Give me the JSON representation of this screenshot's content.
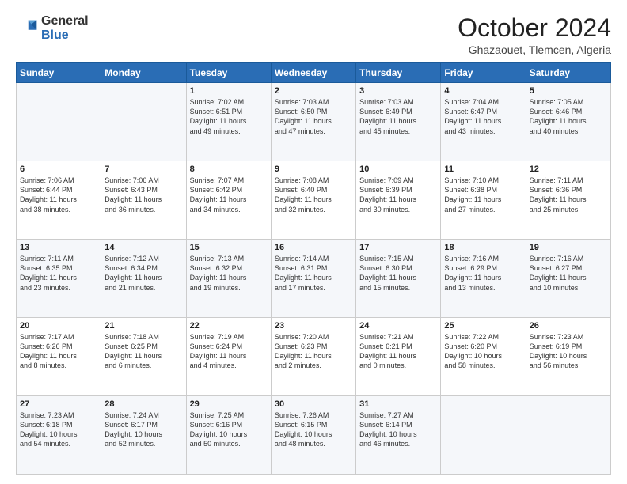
{
  "logo": {
    "general": "General",
    "blue": "Blue"
  },
  "title": "October 2024",
  "location": "Ghazaouet, Tlemcen, Algeria",
  "days_of_week": [
    "Sunday",
    "Monday",
    "Tuesday",
    "Wednesday",
    "Thursday",
    "Friday",
    "Saturday"
  ],
  "weeks": [
    [
      {
        "day": "",
        "info": ""
      },
      {
        "day": "",
        "info": ""
      },
      {
        "day": "1",
        "info": "Sunrise: 7:02 AM\nSunset: 6:51 PM\nDaylight: 11 hours\nand 49 minutes."
      },
      {
        "day": "2",
        "info": "Sunrise: 7:03 AM\nSunset: 6:50 PM\nDaylight: 11 hours\nand 47 minutes."
      },
      {
        "day": "3",
        "info": "Sunrise: 7:03 AM\nSunset: 6:49 PM\nDaylight: 11 hours\nand 45 minutes."
      },
      {
        "day": "4",
        "info": "Sunrise: 7:04 AM\nSunset: 6:47 PM\nDaylight: 11 hours\nand 43 minutes."
      },
      {
        "day": "5",
        "info": "Sunrise: 7:05 AM\nSunset: 6:46 PM\nDaylight: 11 hours\nand 40 minutes."
      }
    ],
    [
      {
        "day": "6",
        "info": "Sunrise: 7:06 AM\nSunset: 6:44 PM\nDaylight: 11 hours\nand 38 minutes."
      },
      {
        "day": "7",
        "info": "Sunrise: 7:06 AM\nSunset: 6:43 PM\nDaylight: 11 hours\nand 36 minutes."
      },
      {
        "day": "8",
        "info": "Sunrise: 7:07 AM\nSunset: 6:42 PM\nDaylight: 11 hours\nand 34 minutes."
      },
      {
        "day": "9",
        "info": "Sunrise: 7:08 AM\nSunset: 6:40 PM\nDaylight: 11 hours\nand 32 minutes."
      },
      {
        "day": "10",
        "info": "Sunrise: 7:09 AM\nSunset: 6:39 PM\nDaylight: 11 hours\nand 30 minutes."
      },
      {
        "day": "11",
        "info": "Sunrise: 7:10 AM\nSunset: 6:38 PM\nDaylight: 11 hours\nand 27 minutes."
      },
      {
        "day": "12",
        "info": "Sunrise: 7:11 AM\nSunset: 6:36 PM\nDaylight: 11 hours\nand 25 minutes."
      }
    ],
    [
      {
        "day": "13",
        "info": "Sunrise: 7:11 AM\nSunset: 6:35 PM\nDaylight: 11 hours\nand 23 minutes."
      },
      {
        "day": "14",
        "info": "Sunrise: 7:12 AM\nSunset: 6:34 PM\nDaylight: 11 hours\nand 21 minutes."
      },
      {
        "day": "15",
        "info": "Sunrise: 7:13 AM\nSunset: 6:32 PM\nDaylight: 11 hours\nand 19 minutes."
      },
      {
        "day": "16",
        "info": "Sunrise: 7:14 AM\nSunset: 6:31 PM\nDaylight: 11 hours\nand 17 minutes."
      },
      {
        "day": "17",
        "info": "Sunrise: 7:15 AM\nSunset: 6:30 PM\nDaylight: 11 hours\nand 15 minutes."
      },
      {
        "day": "18",
        "info": "Sunrise: 7:16 AM\nSunset: 6:29 PM\nDaylight: 11 hours\nand 13 minutes."
      },
      {
        "day": "19",
        "info": "Sunrise: 7:16 AM\nSunset: 6:27 PM\nDaylight: 11 hours\nand 10 minutes."
      }
    ],
    [
      {
        "day": "20",
        "info": "Sunrise: 7:17 AM\nSunset: 6:26 PM\nDaylight: 11 hours\nand 8 minutes."
      },
      {
        "day": "21",
        "info": "Sunrise: 7:18 AM\nSunset: 6:25 PM\nDaylight: 11 hours\nand 6 minutes."
      },
      {
        "day": "22",
        "info": "Sunrise: 7:19 AM\nSunset: 6:24 PM\nDaylight: 11 hours\nand 4 minutes."
      },
      {
        "day": "23",
        "info": "Sunrise: 7:20 AM\nSunset: 6:23 PM\nDaylight: 11 hours\nand 2 minutes."
      },
      {
        "day": "24",
        "info": "Sunrise: 7:21 AM\nSunset: 6:21 PM\nDaylight: 11 hours\nand 0 minutes."
      },
      {
        "day": "25",
        "info": "Sunrise: 7:22 AM\nSunset: 6:20 PM\nDaylight: 10 hours\nand 58 minutes."
      },
      {
        "day": "26",
        "info": "Sunrise: 7:23 AM\nSunset: 6:19 PM\nDaylight: 10 hours\nand 56 minutes."
      }
    ],
    [
      {
        "day": "27",
        "info": "Sunrise: 7:23 AM\nSunset: 6:18 PM\nDaylight: 10 hours\nand 54 minutes."
      },
      {
        "day": "28",
        "info": "Sunrise: 7:24 AM\nSunset: 6:17 PM\nDaylight: 10 hours\nand 52 minutes."
      },
      {
        "day": "29",
        "info": "Sunrise: 7:25 AM\nSunset: 6:16 PM\nDaylight: 10 hours\nand 50 minutes."
      },
      {
        "day": "30",
        "info": "Sunrise: 7:26 AM\nSunset: 6:15 PM\nDaylight: 10 hours\nand 48 minutes."
      },
      {
        "day": "31",
        "info": "Sunrise: 7:27 AM\nSunset: 6:14 PM\nDaylight: 10 hours\nand 46 minutes."
      },
      {
        "day": "",
        "info": ""
      },
      {
        "day": "",
        "info": ""
      }
    ]
  ]
}
